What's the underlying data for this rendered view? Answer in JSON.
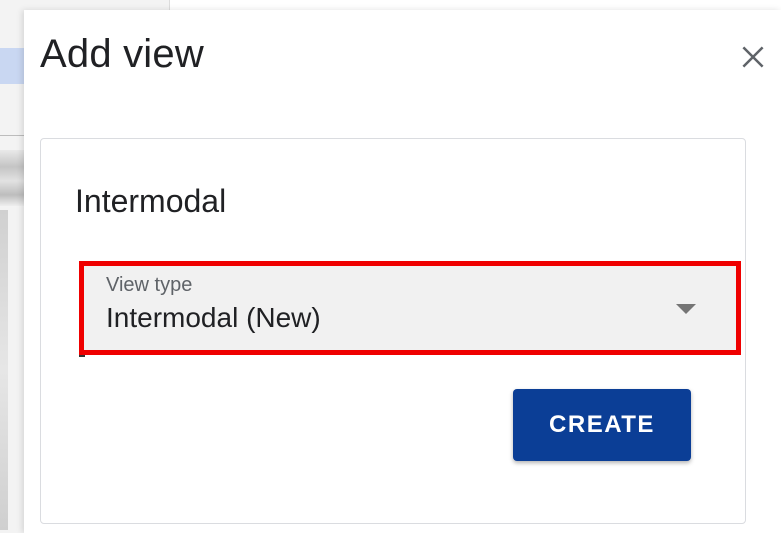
{
  "dialog": {
    "title": "Add view",
    "close_icon": "close-icon"
  },
  "card": {
    "title": "Intermodal",
    "select": {
      "label": "View type",
      "value": "Intermodal (New)",
      "icon": "chevron-down-icon"
    },
    "create_label": "CREATE"
  },
  "colors": {
    "primary_button": "#0b3e96",
    "highlight_border": "#ef0000",
    "field_background": "#f1f1f1"
  }
}
